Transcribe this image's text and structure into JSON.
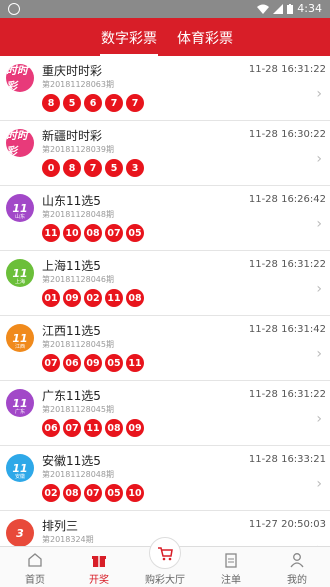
{
  "status": {
    "time": "4:34"
  },
  "header": {
    "tabs": [
      "数字彩票",
      "体育彩票"
    ]
  },
  "lotteries": [
    {
      "name": "重庆时时彩",
      "period": "第20181128063期",
      "time": "11-28 16:31:22",
      "balls": [
        "8",
        "5",
        "6",
        "7",
        "7"
      ],
      "logo_text": "时时彩",
      "logo_color": "#e83a7a"
    },
    {
      "name": "新疆时时彩",
      "period": "第20181128039期",
      "time": "11-28 16:30:22",
      "balls": [
        "0",
        "8",
        "7",
        "5",
        "3"
      ],
      "logo_text": "时时彩",
      "logo_color": "#e83a7a"
    },
    {
      "name": "山东11选5",
      "period": "第20181128048期",
      "time": "11-28 16:26:42",
      "balls": [
        "11",
        "10",
        "08",
        "07",
        "05"
      ],
      "logo_text": "11",
      "logo_sub": "山东",
      "logo_color": "#a248c8"
    },
    {
      "name": "上海11选5",
      "period": "第20181128046期",
      "time": "11-28 16:31:22",
      "balls": [
        "01",
        "09",
        "02",
        "11",
        "08"
      ],
      "logo_text": "11",
      "logo_sub": "上海",
      "logo_color": "#6bbf3a"
    },
    {
      "name": "江西11选5",
      "period": "第20181128045期",
      "time": "11-28 16:31:42",
      "balls": [
        "07",
        "06",
        "09",
        "05",
        "11"
      ],
      "logo_text": "11",
      "logo_sub": "江西",
      "logo_color": "#f08a1c"
    },
    {
      "name": "广东11选5",
      "period": "第20181128045期",
      "time": "11-28 16:31:22",
      "balls": [
        "06",
        "07",
        "11",
        "08",
        "09"
      ],
      "logo_text": "11",
      "logo_sub": "广东",
      "logo_color": "#a248c8"
    },
    {
      "name": "安徽11选5",
      "period": "第20181128048期",
      "time": "11-28 16:33:21",
      "balls": [
        "02",
        "08",
        "07",
        "05",
        "10"
      ],
      "logo_text": "11",
      "logo_sub": "安徽",
      "logo_color": "#2ea8e8"
    },
    {
      "name": "排列三",
      "period": "第2018324期",
      "time": "11-27 20:50:03",
      "balls": [],
      "logo_text": "3",
      "logo_color": "#e84a3a"
    }
  ],
  "tabbar": {
    "home": "首页",
    "prize": "开奖",
    "lobby": "购彩大厅",
    "bet": "注单",
    "mine": "我的"
  }
}
